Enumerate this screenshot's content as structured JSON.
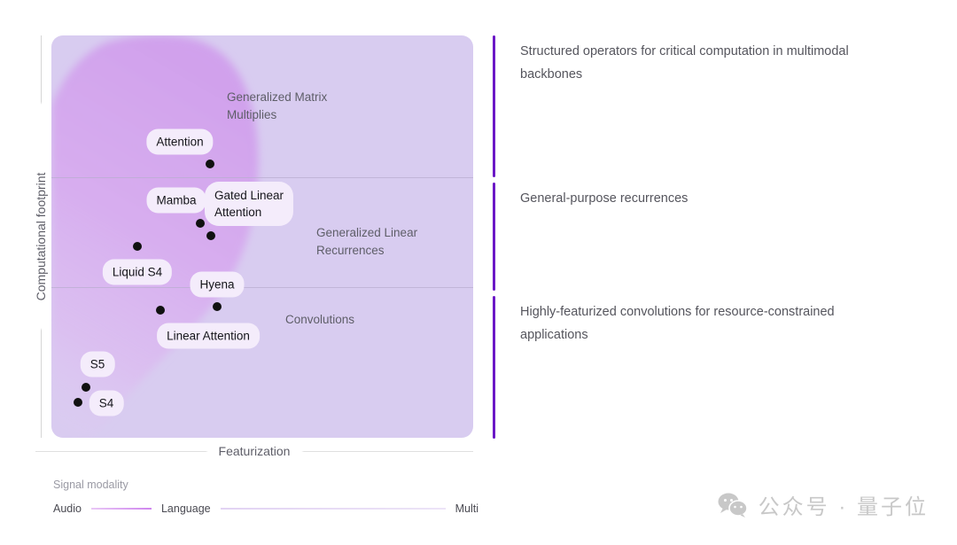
{
  "chart_data": {
    "type": "scatter",
    "title": "",
    "xlabel": "Featurization",
    "ylabel": "Computational footprint",
    "grid": false,
    "xlim": [
      0,
      1
    ],
    "ylim": [
      0,
      1
    ],
    "legend_position": "bottom-left",
    "regions": [
      {
        "label": "Generalized Matrix\nMultiplies",
        "x": 0.42,
        "y": 0.87
      },
      {
        "label": "Generalized Linear\nRecurrences",
        "x": 0.63,
        "y": 0.53
      },
      {
        "label": "Convolutions",
        "x": 0.56,
        "y": 0.3
      }
    ],
    "points": [
      {
        "name": "Attention",
        "x": 0.376,
        "y": 0.681,
        "label_x": 0.305,
        "label_y": 0.735
      },
      {
        "name": "Mamba",
        "x": 0.353,
        "y": 0.534,
        "label_x": 0.296,
        "label_y": 0.602
      },
      {
        "name": "Gated Linear\nAttention",
        "x": 0.378,
        "y": 0.503,
        "label_x": 0.468,
        "label_y": 0.58
      },
      {
        "name": "Liquid S4",
        "x": 0.204,
        "y": 0.477,
        "label_x": 0.203,
        "label_y": 0.418
      },
      {
        "name": "Hyena",
        "x": 0.393,
        "y": 0.327,
        "label_x": 0.392,
        "label_y": 0.387
      },
      {
        "name": "Linear Attention",
        "x": 0.258,
        "y": 0.336,
        "label_x": 0.37,
        "label_y": 0.257
      },
      {
        "name": "S5",
        "x": 0.082,
        "y": 0.145,
        "label_x": 0.109,
        "label_y": 0.192
      },
      {
        "name": "S4",
        "x": 0.063,
        "y": 0.108,
        "label_x": 0.13,
        "label_y": 0.102
      }
    ],
    "legend": {
      "title": "Signal modality",
      "stops": [
        "Audio",
        "Language",
        "Multi"
      ]
    },
    "colors": {
      "panel_background": "#d8ccf0",
      "blob": "#d5a8ee",
      "point": "#111111",
      "chip_background": "#f4ecfb",
      "accent": "#6b18c6"
    }
  },
  "annotations": [
    {
      "text": "Structured operators for critical computation in multimodal backbones"
    },
    {
      "text": "General-purpose recurrences"
    },
    {
      "text": "Highly-featurized convolutions for resource-constrained applications"
    }
  ],
  "watermark": {
    "text": "公众号 · 量子位",
    "icon": "wechat-icon"
  }
}
